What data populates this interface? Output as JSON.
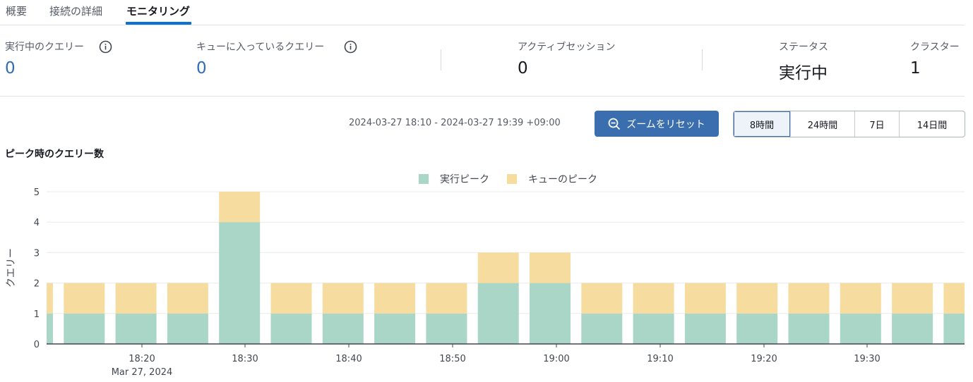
{
  "tabs": [
    {
      "label": "概要"
    },
    {
      "label": "接続の詳細"
    },
    {
      "label": "モニタリング"
    }
  ],
  "metrics": {
    "running_queries": {
      "label": "実行中のクエリー",
      "value": "0"
    },
    "queued_queries": {
      "label": "キューに入っているクエリー",
      "value": "0"
    },
    "active_sessions": {
      "label": "アクティブセッション",
      "value": "0"
    },
    "status": {
      "label": "ステータス",
      "value": "実行中"
    },
    "clusters": {
      "label": "クラスター",
      "value": "1"
    }
  },
  "time_range": "2024-03-27 18:10 - 2024-03-27 19:39 +09:00",
  "reset_zoom_label": "ズームをリセット",
  "range_options": [
    {
      "label": "8時間",
      "selected": true
    },
    {
      "label": "24時間",
      "selected": false
    },
    {
      "label": "7日",
      "selected": false
    },
    {
      "label": "14日間",
      "selected": false
    }
  ],
  "colors": {
    "running": "#a9d6c6",
    "queued": "#f7dc9f",
    "accent": "#3a6eaf"
  },
  "chart_data": {
    "type": "bar",
    "stacked": true,
    "title": "ピーク時のクエリー数",
    "ylabel": "クエリー",
    "ylim": [
      0,
      5
    ],
    "yticks": [
      0,
      1,
      2,
      3,
      4,
      5
    ],
    "x": [
      "18:10",
      "18:15",
      "18:20",
      "18:25",
      "18:30",
      "18:35",
      "18:40",
      "18:45",
      "18:50",
      "18:55",
      "19:00",
      "19:05",
      "19:10",
      "19:15",
      "19:20",
      "19:25",
      "19:30",
      "19:35",
      "19:40"
    ],
    "series": [
      {
        "name": "実行ピーク",
        "color": "#a9d6c6",
        "values": [
          1,
          1,
          1,
          1,
          4,
          1,
          1,
          1,
          1,
          2,
          2,
          1,
          1,
          1,
          1,
          1,
          1,
          1,
          1
        ]
      },
      {
        "name": "キューのピーク",
        "color": "#f7dc9f",
        "values": [
          1,
          1,
          1,
          1,
          1,
          1,
          1,
          1,
          1,
          1,
          1,
          1,
          1,
          1,
          1,
          1,
          1,
          1,
          1
        ]
      }
    ],
    "xticks": [
      {
        "label": "18:20",
        "sublabel": "Mar 27, 2024"
      },
      {
        "label": "18:30"
      },
      {
        "label": "18:40"
      },
      {
        "label": "18:50"
      },
      {
        "label": "19:00"
      },
      {
        "label": "19:10"
      },
      {
        "label": "19:20"
      },
      {
        "label": "19:30"
      }
    ],
    "legend_position": "top-center",
    "grid": true
  }
}
